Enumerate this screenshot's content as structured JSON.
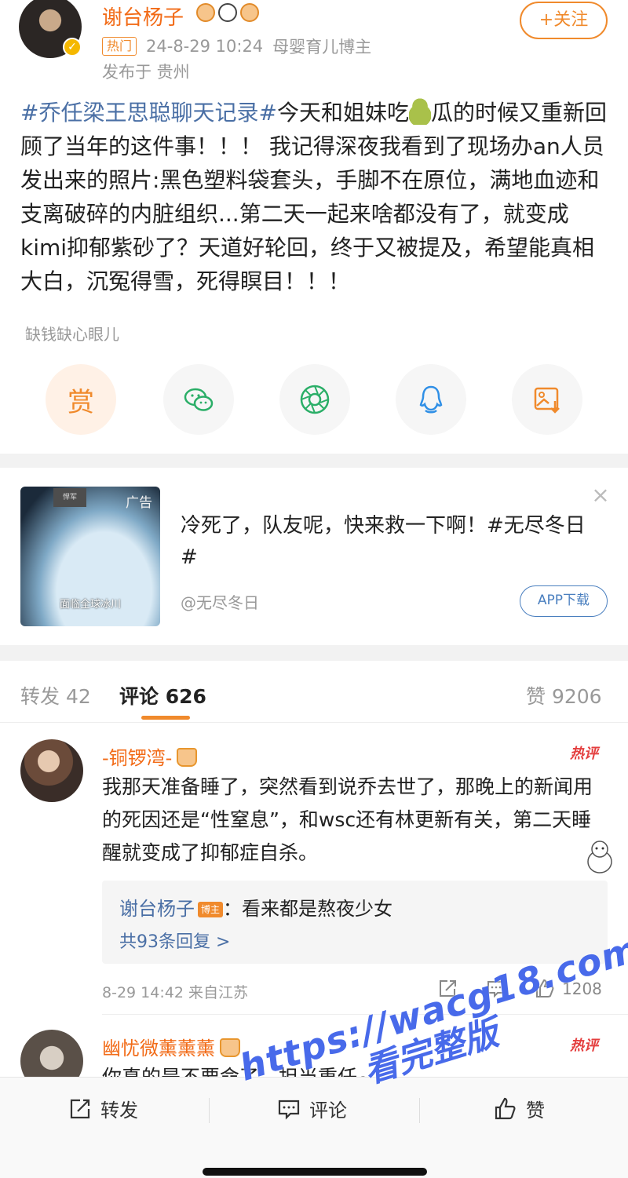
{
  "post": {
    "author": "谢台杨子",
    "hot_tag": "热门",
    "datetime": "24-8-29 10:24",
    "author_role": "母婴育儿博主",
    "location": "发布于 贵州",
    "follow_label": "+关注",
    "verified_icon": "verified-check-icon",
    "topic": "#乔任梁王思聪聊天记录#",
    "text_before_emoji": "今天和姐妹吃",
    "emoji_icon": "pear-emoji",
    "text_after_emoji": "瓜的时候又重新回顾了当年的这件事！！！ 我记得深夜我看到了现场办an人员发出来的照片:黑色塑料袋套头，手脚不在原位，满地血迹和支离破碎的内脏组织...第二天一起来啥都没有了，就变成kimi抑郁紫砂了？天道好轮回，终于又被提及，希望能真相大白，沉冤得雪，死得瞑目！！！",
    "tip_caption": "缺钱缺心眼儿"
  },
  "share": {
    "reward_label": "赏",
    "icons": [
      "reward-icon",
      "wechat-icon",
      "moments-icon",
      "qq-icon",
      "save-image-icon"
    ]
  },
  "ad": {
    "thumb_tag": "广告",
    "thumb_small_label": "悍军",
    "thumb_caption": "面临全球冰川",
    "text": "冷死了，队友呢，快来救一下啊！#无尽冬日#",
    "source": "@无尽冬日",
    "download_label": "APP下载"
  },
  "tabs": {
    "repost": "转发 42",
    "comments": "评论 626",
    "likes": "赞 9206"
  },
  "comments": [
    {
      "name": "-铜锣湾-",
      "hot_mark": "热评",
      "text": "我那天准备睡了，突然看到说乔去世了，那晚上的新闻用的死因还是“性窒息”，和wsc还有林更新有关，第二天睡醒就变成了抑郁症自杀。",
      "reply_name": "谢台杨子",
      "reply_tag": "博主",
      "reply_text": "：看来都是熬夜少女",
      "reply_more": "共93条回复 >",
      "meta": "8-29 14:42 来自江苏",
      "like_count": "1208"
    },
    {
      "name": "幽忧微薰薰薰",
      "hot_mark": "热评",
      "text": "你真的是不要命了，担当重任~"
    }
  ],
  "bottom_bar": {
    "repost": "转发",
    "comment": "评论",
    "like": "赞"
  },
  "watermark": {
    "line1": "https://wacg18.com",
    "line2": "看完整版"
  },
  "colors": {
    "accent": "#f08a2c",
    "username": "#f26b17",
    "topic_link": "#4a6fa5",
    "hot": "#e43f3f",
    "watermark": "#2850e6"
  }
}
